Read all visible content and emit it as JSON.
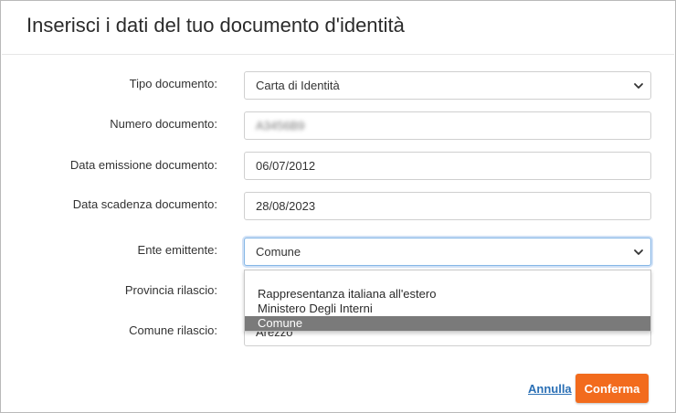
{
  "dialog": {
    "title": "Inserisci i dati del tuo documento d'identità"
  },
  "form": {
    "tipo_documento": {
      "label": "Tipo documento:",
      "value": "Carta di Identità"
    },
    "numero_documento": {
      "label": "Numero documento:",
      "value": "A3456B9"
    },
    "data_emissione": {
      "label": "Data emissione documento:",
      "value": "06/07/2012"
    },
    "data_scadenza": {
      "label": "Data scadenza documento:",
      "value": "28/08/2023"
    },
    "ente_emittente": {
      "label": "Ente emittente:",
      "value": "Comune",
      "options": [
        "",
        "Rappresentanza italiana all'estero",
        "Ministero Degli Interni",
        "Comune"
      ]
    },
    "provincia_rilascio": {
      "label": "Provincia rilascio:"
    },
    "comune_rilascio": {
      "label": "Comune rilascio:",
      "value": "Arezzo"
    }
  },
  "actions": {
    "cancel_label": "Annulla",
    "confirm_label": "Conferma"
  },
  "colors": {
    "accent": "#f26b1d",
    "link": "#2a6fb5",
    "selected_option": "#7a7a7a"
  }
}
